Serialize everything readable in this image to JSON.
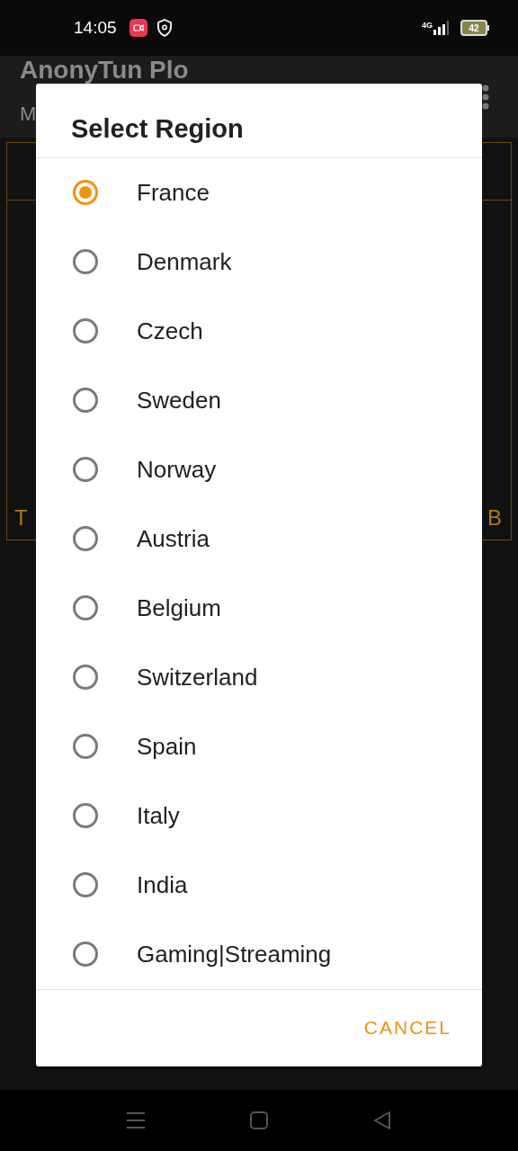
{
  "status_bar": {
    "time": "14:05",
    "network": "4G",
    "battery": "42"
  },
  "background_app": {
    "title": "AnonyTun Plo",
    "subtitle": "M",
    "left_label": "T",
    "right_label": "B"
  },
  "dialog": {
    "title": "Select Region",
    "options": [
      {
        "label": "France",
        "selected": true
      },
      {
        "label": "Denmark",
        "selected": false
      },
      {
        "label": "Czech",
        "selected": false
      },
      {
        "label": "Sweden",
        "selected": false
      },
      {
        "label": "Norway",
        "selected": false
      },
      {
        "label": "Austria",
        "selected": false
      },
      {
        "label": "Belgium",
        "selected": false
      },
      {
        "label": "Switzerland",
        "selected": false
      },
      {
        "label": "Spain",
        "selected": false
      },
      {
        "label": "Italy",
        "selected": false
      },
      {
        "label": "India",
        "selected": false
      },
      {
        "label": "Gaming|Streaming",
        "selected": false
      }
    ],
    "buttons": [
      "CANCEL"
    ]
  }
}
